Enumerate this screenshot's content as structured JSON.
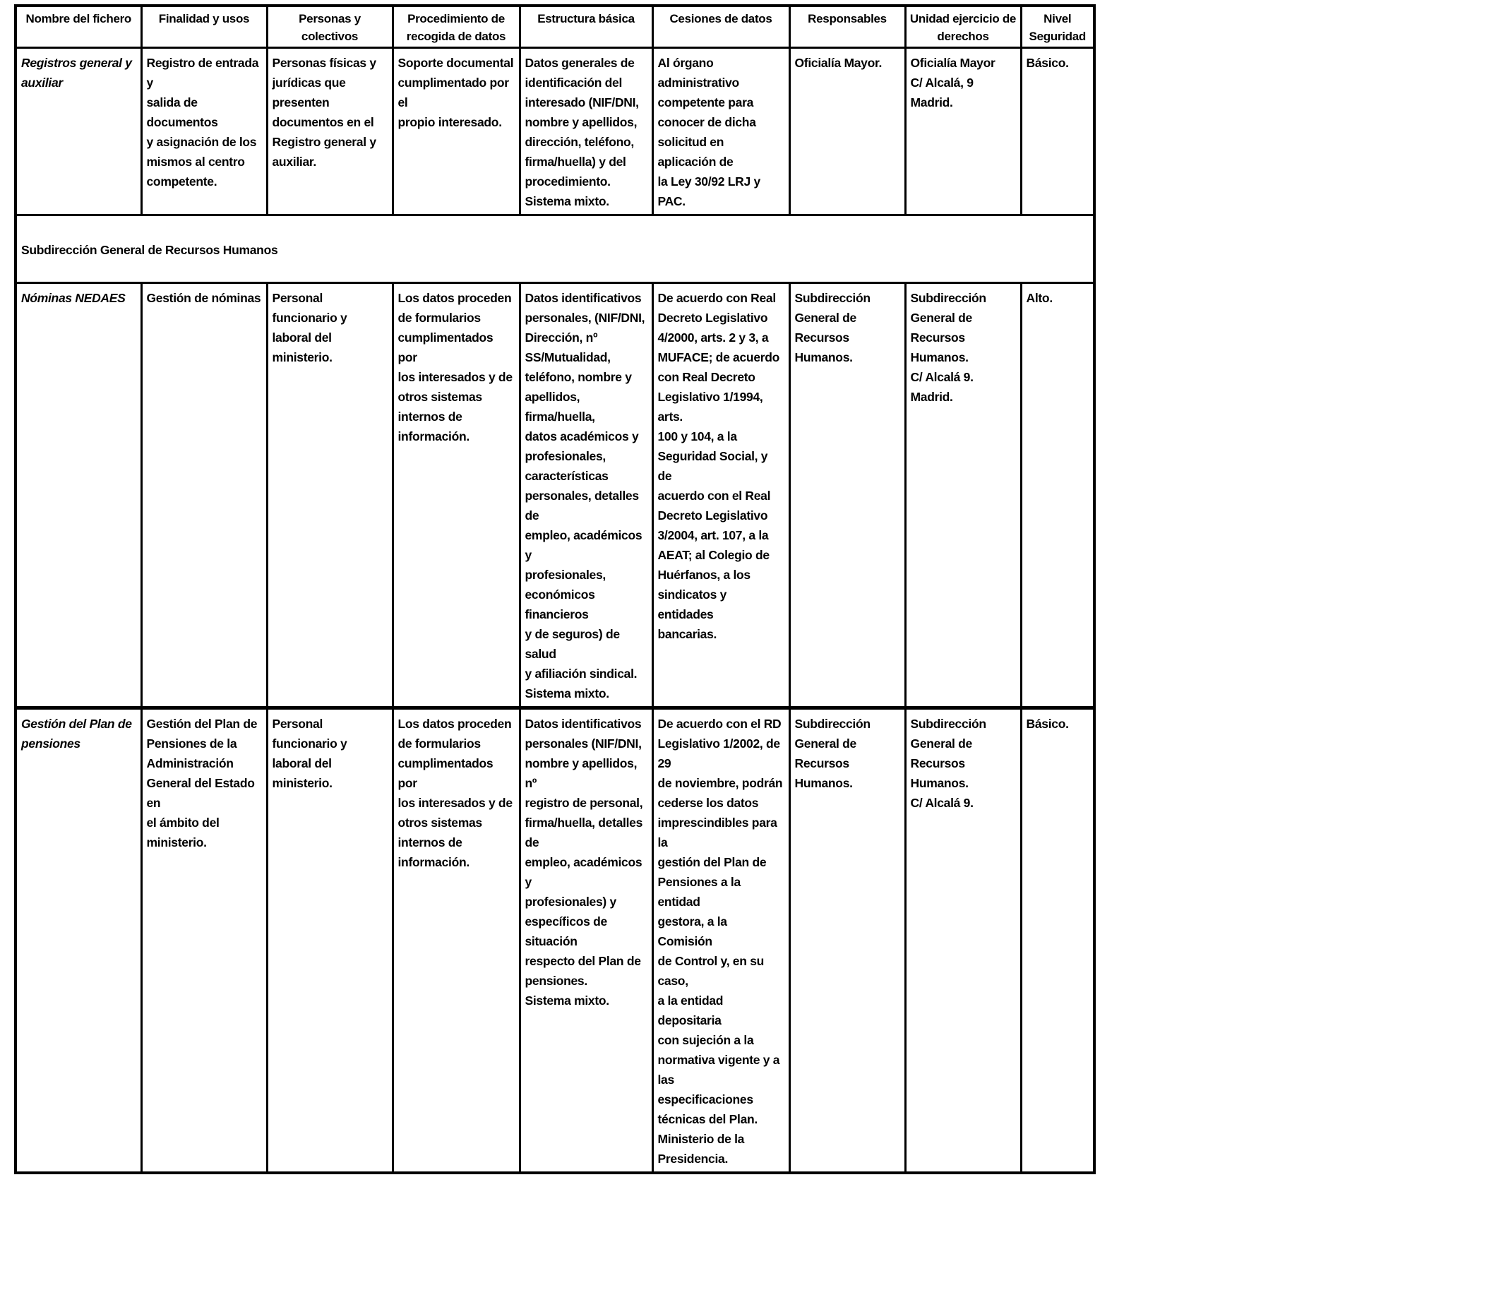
{
  "table": {
    "headers": [
      "Nombre del fichero",
      "Finalidad y usos",
      "Personas y\ncolectivos",
      "Procedimiento de\nrecogida de datos",
      "Estructura básica",
      "Cesiones de datos",
      "Responsables",
      "Unidad ejercicio de\nderechos",
      "Nivel\nSeguridad"
    ],
    "rows": [
      {
        "name_part1": "Registros general y\nauxiliar",
        "name_part2": "",
        "cells": [
          "Registro de entrada y\nsalida de documentos\ny asignación de los\nmismos al centro\ncompetente.",
          "Personas físicas y\njurídicas que\npresenten\ndocumentos en el\nRegistro general y\nauxiliar.",
          "Soporte documental\ncumplimentado por el\npropio interesado.",
          "Datos generales de\nidentificación del\ninteresado (NIF/DNI,\nnombre y apellidos,\ndirección, teléfono,\nfirma/huella) y del\nprocedimiento.\nSistema mixto.",
          "Al órgano administrativo\ncompetente para\nconocer de dicha\nsolicitud en aplicación de\nla Ley 30/92 LRJ y PAC.",
          "Oficialía Mayor.",
          "Oficialía Mayor\nC/ Alcalá, 9 Madrid.",
          "Básico."
        ]
      },
      {
        "name_part1": "Nóminas NEDAES",
        "name_part2": "",
        "cells": [
          "Gestión de nóminas",
          "Personal funcionario y\nlaboral del ministerio.",
          "Los datos proceden\nde formularios\ncumplimentados por\nlos interesados y de\notros sistemas\ninternos de\ninformación.",
          "Datos identificativos\npersonales, (NIF/DNI,\nDirección, nº\nSS/Mutualidad,\nteléfono, nombre y\napellidos, firma/huella,\ndatos académicos y\nprofesionales,\ncaracterísticas\npersonales, detalles de\nempleo, académicos y\nprofesionales,\neconómicos financieros\ny de seguros) de salud\ny afiliación sindical.\nSistema mixto.",
          "De acuerdo con Real\nDecreto Legislativo\n4/2000, arts. 2 y 3, a\nMUFACE; de acuerdo\ncon Real Decreto\nLegislativo 1/1994, arts.\n100 y 104, a la\nSeguridad Social, y de\nacuerdo con el Real\nDecreto Legislativo\n3/2004, art. 107, a la\nAEAT; al Colegio de\nHuérfanos, a los\nsindicatos y entidades\nbancarias.",
          "Subdirección\nGeneral de\nRecursos Humanos.",
          "Subdirección\nGeneral de\nRecursos Humanos.\nC/ Alcalá 9. Madrid.",
          "Alto."
        ]
      },
      {
        "name_part1": "Gestión del ",
        "name_part2": "Plan de\npensiones",
        "cells": [
          "Gestión del Plan de\nPensiones de la\nAdministración\nGeneral del Estado en\nel ámbito del\nministerio.",
          "Personal funcionario y\nlaboral del ministerio.",
          "Los datos proceden\nde formularios\ncumplimentados por\nlos interesados y de\notros sistemas\ninternos de\ninformación.",
          "Datos identificativos\npersonales (NIF/DNI,\nnombre y apellidos, nº\nregistro de personal,\nfirma/huella, detalles de\nempleo, académicos y\nprofesionales) y\nespecíficos de situación\nrespecto del Plan de\npensiones.\nSistema mixto.",
          "De acuerdo con el RD\nLegislativo 1/2002, de 29\nde noviembre, podrán\ncederse los datos\nimprescindibles para la\ngestión del Plan de\nPensiones a la entidad\ngestora, a la Comisión\nde Control y, en su caso,\na la entidad depositaria\ncon sujeción a la\nnormativa vigente y a las\nespecificaciones\ntécnicas del Plan.\nMinisterio de la\nPresidencia.",
          "Subdirección\nGeneral de\nRecursos Humanos.",
          "Subdirección\nGeneral de\nRecursos Humanos.\nC/ Alcalá 9.",
          "Básico."
        ]
      }
    ],
    "section_title": "Subdirección General de Recursos Humanos"
  }
}
